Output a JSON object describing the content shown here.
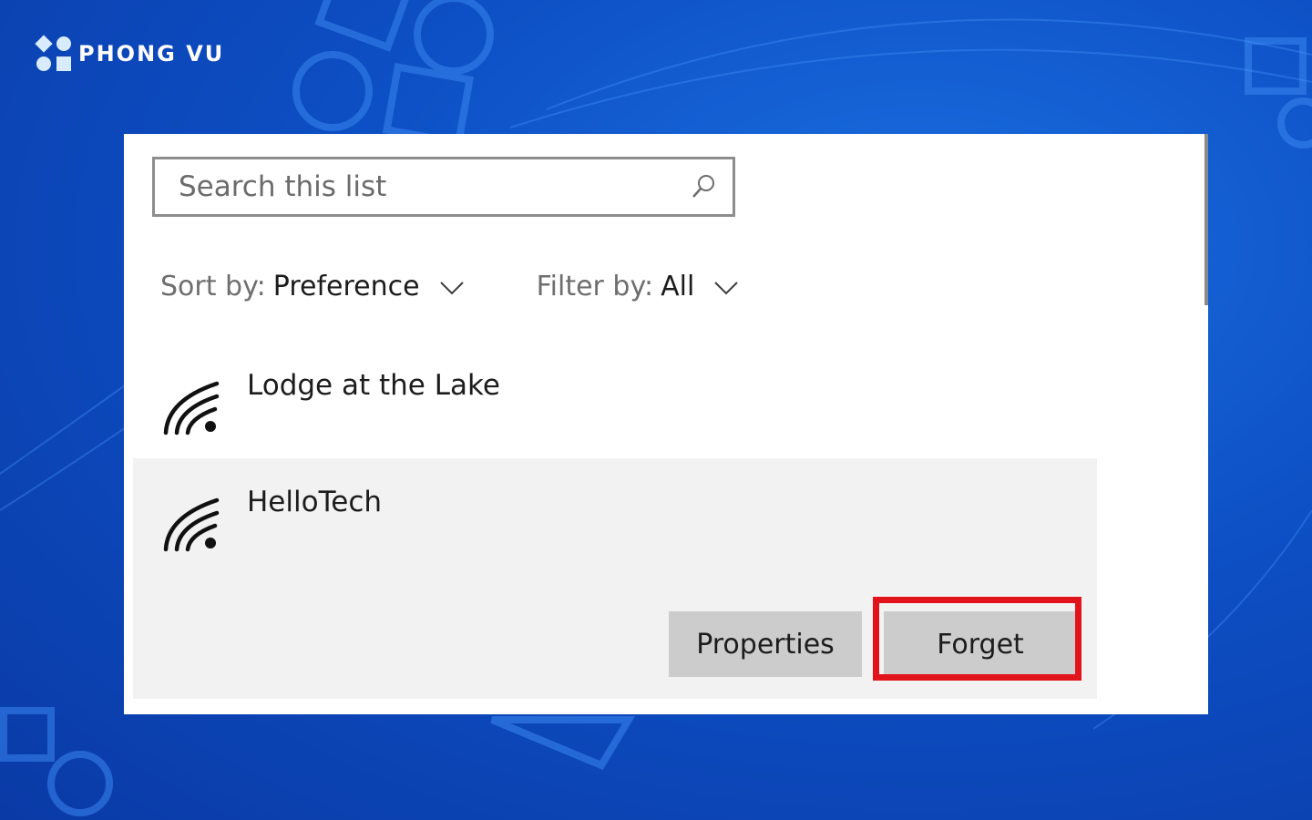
{
  "brand": {
    "name": "PHONG VU"
  },
  "search": {
    "placeholder": "Search this list",
    "icon": "search-icon"
  },
  "sort": {
    "label": "Sort by:",
    "value": "Preference"
  },
  "filter": {
    "label": "Filter by:",
    "value": "All"
  },
  "networks": [
    {
      "name": "Lodge at the Lake",
      "icon": "wifi-icon"
    },
    {
      "name": "HelloTech",
      "icon": "wifi-icon",
      "selected": true,
      "actions": {
        "properties": "Properties",
        "forget": "Forget"
      }
    }
  ],
  "colors": {
    "background": "#0d4fc4",
    "panel": "#ffffff",
    "selected_row": "#f2f2f2",
    "button": "#cccccc",
    "highlight": "#e2141b"
  }
}
